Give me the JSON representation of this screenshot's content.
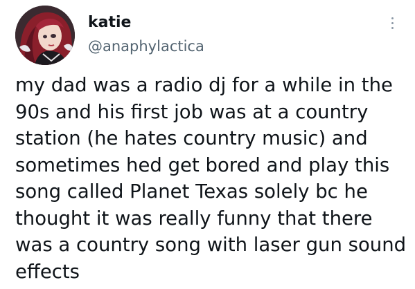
{
  "author": {
    "display_name": "katie",
    "handle": "@anaphylactica",
    "avatar_icon": "anime-character-avatar-icon"
  },
  "tweet": {
    "lines": [
      "my dad was a radio dj for a while in the",
      "90s and his first job was at a country",
      "station (he hates country music) and",
      "sometimes hed get bored and play this",
      "song called Planet Texas solely bc he",
      "thought it was really funny that there",
      "was a country song with laser gun sound",
      "effects"
    ]
  },
  "menu": {
    "icon": "more-vertical-icon"
  },
  "colors": {
    "text": "#0f1419",
    "secondary_text": "#536471",
    "background": "#ffffff"
  }
}
